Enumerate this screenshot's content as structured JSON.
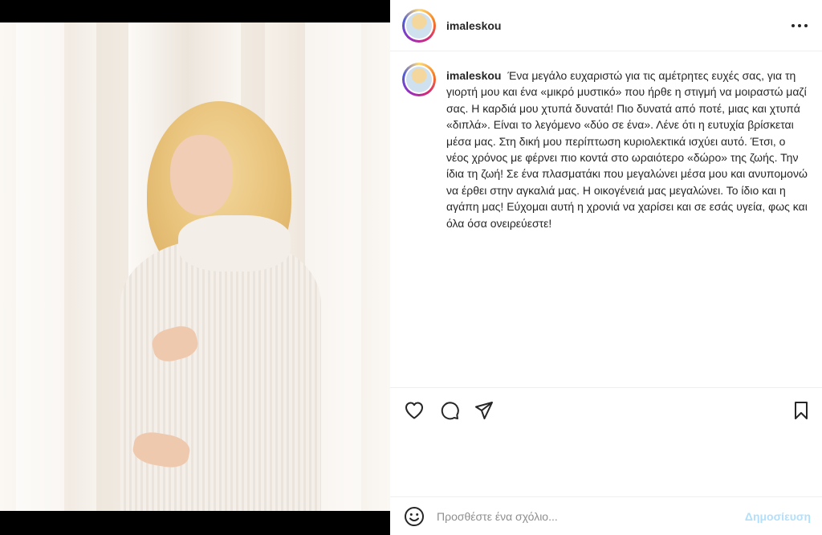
{
  "post": {
    "username": "imaleskou",
    "caption": "Ένα μεγάλο ευχαριστώ για τις αμέτρητες ευχές σας, για τη γιορτή μου και ένα «μικρό μυστικό» που ήρθε η στιγμή να μοιραστώ μαζί σας. Η καρδιά μου χτυπά δυνατά! Πιο δυνατά από ποτέ, μιας και χτυπά «διπλά». Είναι το λεγόμενο «δύο σε ένα». Λένε ότι η ευτυχία βρίσκεται μέσα μας. Στη δική μου περίπτωση κυριολεκτικά ισχύει αυτό. Έτσι, ο νέος χρόνος με φέρνει πιο κοντά στο ωραιότερο «δώρο» της ζωής. Την ίδια τη ζωή! Σε ένα πλασματάκι που μεγαλώνει μέσα μου και ανυπομονώ να έρθει στην αγκαλιά μας. Η οικογένειά μας μεγαλώνει. Το ίδιο και η αγάπη μας! Εύχομαι αυτή η χρονιά να χαρίσει και σε εσάς υγεία, φως και όλα όσα ονειρεύεστε!"
  },
  "icons": {
    "more": "more-options-icon",
    "like": "heart-icon",
    "comment": "comment-bubble-icon",
    "share": "paper-plane-icon",
    "save": "bookmark-icon",
    "emoji": "smiley-icon"
  },
  "comment_box": {
    "placeholder": "Προσθέστε ένα σχόλιο...",
    "post_label": "Δημοσίευση"
  },
  "colors": {
    "post_button_disabled": "#b2dffc",
    "text": "#262626"
  }
}
